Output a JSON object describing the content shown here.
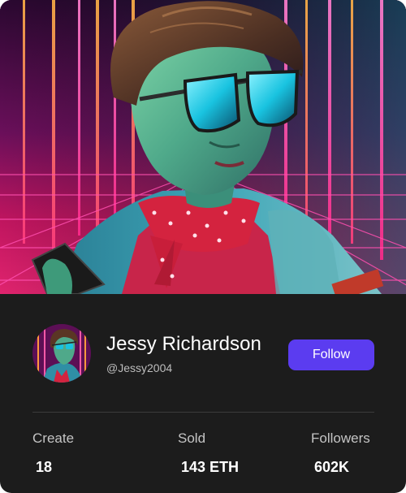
{
  "profile": {
    "name": "Jessy Richardson",
    "handle": "@Jessy2004",
    "follow_label": "Follow"
  },
  "stats": [
    {
      "label": "Create",
      "value": "18"
    },
    {
      "label": "Sold",
      "value": "143 ETH"
    },
    {
      "label": "Followers",
      "value": "602K"
    }
  ],
  "colors": {
    "card_background": "#1c1c1c",
    "follow_button": "#5b3cf0",
    "neon_pink": "#ff2a8a",
    "neon_orange": "#ff9a3c",
    "neon_cyan": "#27d4e6"
  }
}
